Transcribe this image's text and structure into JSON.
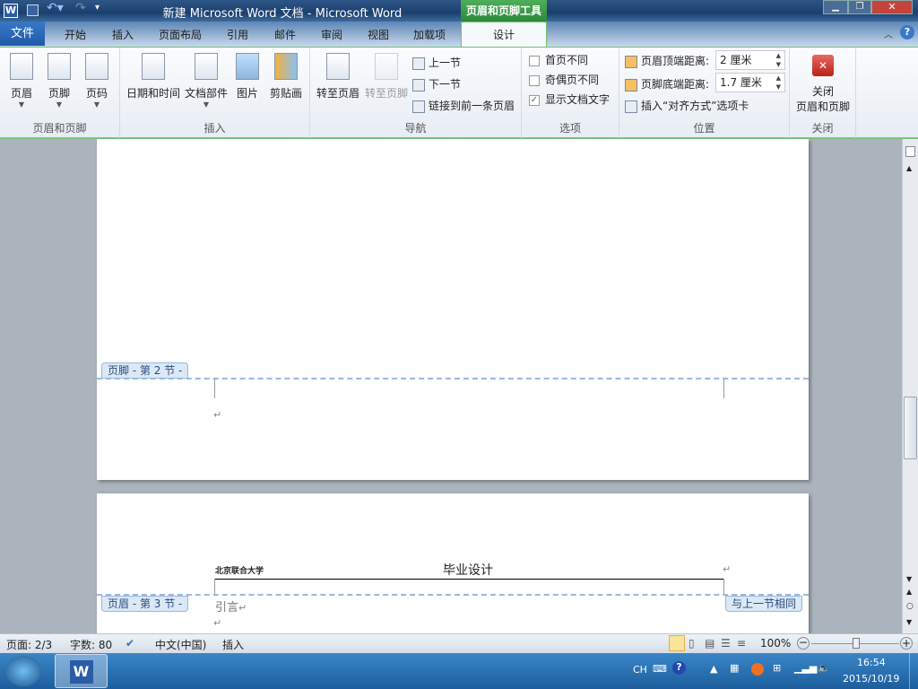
{
  "window": {
    "title": "新建 Microsoft Word 文档 - Microsoft Word",
    "context_tab_group": "页眉和页脚工具"
  },
  "tabs": {
    "file": "文件",
    "items": [
      "开始",
      "插入",
      "页面布局",
      "引用",
      "邮件",
      "审阅",
      "视图",
      "加载项"
    ],
    "design": "设计"
  },
  "ribbon": {
    "hf": {
      "label": "页眉和页脚",
      "header": "页眉",
      "footer": "页脚",
      "page_number": "页码"
    },
    "insert": {
      "label": "插入",
      "datetime": "日期和时间",
      "quickparts": "文档部件",
      "picture": "图片",
      "clipart": "剪贴画"
    },
    "nav": {
      "label": "导航",
      "goto_header": "转至页眉",
      "goto_footer": "转至页脚",
      "prev": "上一节",
      "next": "下一节",
      "link": "链接到前一条页眉"
    },
    "options": {
      "label": "选项",
      "first_page": "首页不同",
      "odd_even": "奇偶页不同",
      "show_text": "显示文档文字",
      "first_checked": false,
      "odd_checked": false,
      "show_checked": true
    },
    "position": {
      "label": "位置",
      "header_top": "页眉顶端距离:",
      "header_val": "2 厘米",
      "footer_bottom": "页脚底端距离:",
      "footer_val": "1.7 厘米",
      "insert_align": "插入“对齐方式”选项卡"
    },
    "close": {
      "label": "关闭",
      "btn_line1": "关闭",
      "btn_line2": "页眉和页脚"
    }
  },
  "doc": {
    "footer_tag": "页脚 - 第 2 节 -",
    "header_tag": "页眉 - 第 3 节 -",
    "same_as_prev": "与上一节相同",
    "header_logo": "北京联合大学",
    "header_title": "毕业设计",
    "body_text": "引言",
    "para_mark": "↵"
  },
  "status": {
    "page": "页面: 2/3",
    "words": "字数: 80",
    "lang": "中文(中国)",
    "mode": "插入",
    "zoom": "100%",
    "zoom_percent": 100
  },
  "taskbar": {
    "ime": "CH",
    "time": "16:54",
    "date": "2015/10/19"
  }
}
